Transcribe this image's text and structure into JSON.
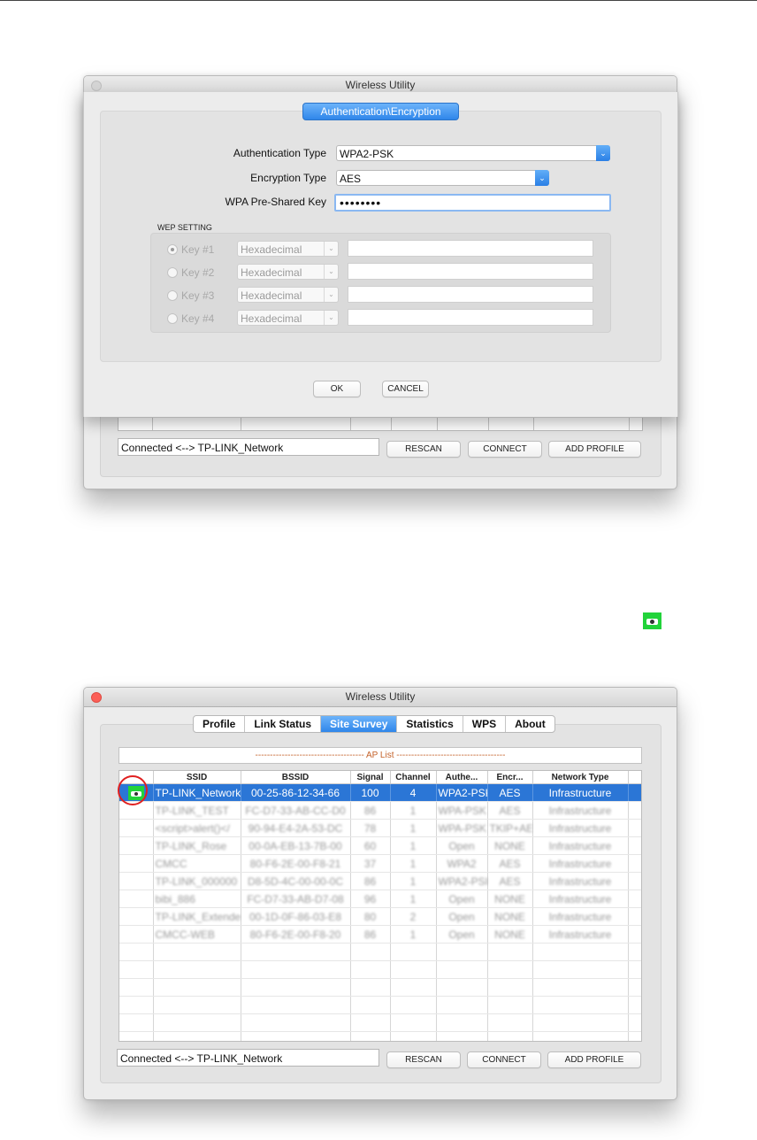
{
  "top_window": {
    "title": "Wireless Utility",
    "dialog": {
      "tab_label": "Authentication\\Encryption",
      "auth_type_label": "Authentication Type",
      "auth_type_value": "WPA2-PSK",
      "enc_type_label": "Encryption Type",
      "enc_type_value": "AES",
      "psk_label": "WPA Pre-Shared Key",
      "psk_value": "••••••••",
      "wep_setting_label": "WEP SETTING",
      "wep_keys": [
        {
          "label": "Key #1",
          "format": "Hexadecimal",
          "selected": true
        },
        {
          "label": "Key #2",
          "format": "Hexadecimal",
          "selected": false
        },
        {
          "label": "Key #3",
          "format": "Hexadecimal",
          "selected": false
        },
        {
          "label": "Key #4",
          "format": "Hexadecimal",
          "selected": false
        }
      ],
      "ok_label": "OK",
      "cancel_label": "CANCEL"
    },
    "status_text": "Connected <--> TP-LINK_Network",
    "rescan_label": "RESCAN",
    "connect_label": "CONNECT",
    "add_profile_label": "ADD PROFILE"
  },
  "bottom_window": {
    "title": "Wireless Utility",
    "tabs": [
      "Profile",
      "Link Status",
      "Site Survey",
      "Statistics",
      "WPS",
      "About"
    ],
    "active_tab": "Site Survey",
    "ap_list_header": "------------------------------------- AP List -------------------------------------",
    "columns": [
      "",
      "SSID",
      "BSSID",
      "Signal",
      "Channel",
      "Authe...",
      "Encr...",
      "Network Type"
    ],
    "rows": [
      [
        "TP-LINK_Network",
        "00-25-86-12-34-66",
        "100",
        "4",
        "WPA2-PSK",
        "AES",
        "Infrastructure"
      ],
      [
        "TP-LINK_TEST",
        "FC-D7-33-AB-CC-D0",
        "86",
        "1",
        "WPA-PSK",
        "AES",
        "Infrastructure"
      ],
      [
        "<script>alert()</",
        "90-94-E4-2A-53-DC",
        "78",
        "1",
        "WPA-PSK",
        "TKIP+AES",
        "Infrastructure"
      ],
      [
        "TP-LINK_Rose",
        "00-0A-EB-13-7B-00",
        "60",
        "1",
        "Open",
        "NONE",
        "Infrastructure"
      ],
      [
        "CMCC",
        "80-F6-2E-00-F8-21",
        "37",
        "1",
        "WPA2",
        "AES",
        "Infrastructure"
      ],
      [
        "TP-LINK_000000",
        "D8-5D-4C-00-00-0C",
        "86",
        "1",
        "WPA2-PSK",
        "AES",
        "Infrastructure"
      ],
      [
        "bibi_886",
        "FC-D7-33-AB-D7-08",
        "96",
        "1",
        "Open",
        "NONE",
        "Infrastructure"
      ],
      [
        "TP-LINK_Extender",
        "00-1D-0F-86-03-E8",
        "80",
        "2",
        "Open",
        "NONE",
        "Infrastructure"
      ],
      [
        "CMCC-WEB",
        "80-F6-2E-00-F8-20",
        "86",
        "1",
        "Open",
        "NONE",
        "Infrastructure"
      ]
    ],
    "empty_rows": 6,
    "status_text": "Connected <--> TP-LINK_Network",
    "rescan_label": "RESCAN",
    "connect_label": "CONNECT",
    "add_profile_label": "ADD PROFILE"
  }
}
